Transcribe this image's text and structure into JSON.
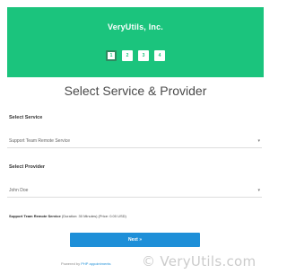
{
  "header": {
    "brand": "VeryUtils, Inc.",
    "steps": [
      "1",
      "2",
      "3",
      "4"
    ],
    "active_step": 0,
    "bg_color": "#1bc47d"
  },
  "main": {
    "title": "Select Service & Provider",
    "service": {
      "label": "Select Service",
      "value": "Support Team Remote Service"
    },
    "provider": {
      "label": "Select Provider",
      "value": "John Doe"
    },
    "summary": {
      "name": "Support Team Remote Service",
      "details": "(Duration: 30 Minutes) (Price: 0.00 USD)"
    },
    "next_label": "Next »"
  },
  "footer": {
    "powered_prefix": "Powered by",
    "powered_link": "PHP appointments",
    "watermark": "© VeryUtils.com"
  },
  "colors": {
    "accent": "#1bc47d",
    "button": "#1e8fd8"
  }
}
